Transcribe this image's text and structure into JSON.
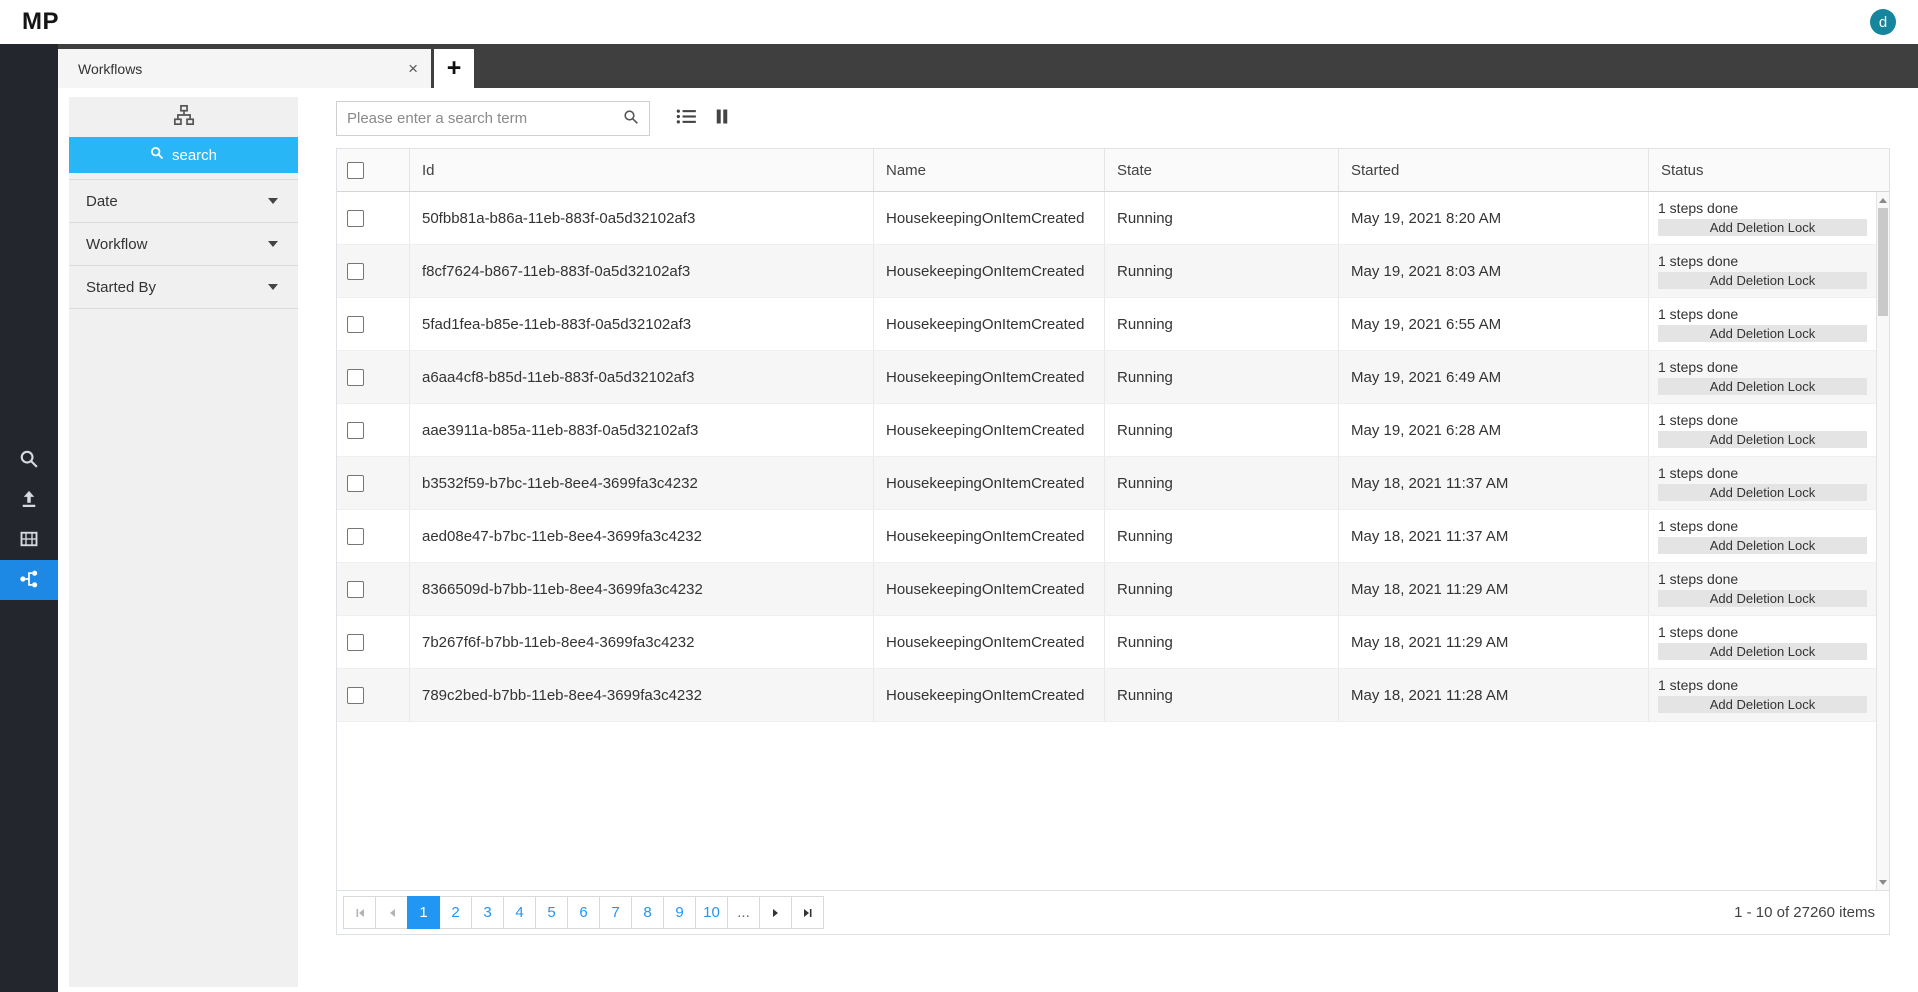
{
  "colors": {
    "rail_dark": "#23272d",
    "tabbar_dark": "#3f3f3f",
    "rail_active_blue": "#1e88e5",
    "search_button_blue": "#29b6f6",
    "pager_selected_blue": "#2196f3",
    "avatar_teal": "#15869e",
    "panel_gray": "#f0f0f0"
  },
  "topbar": {
    "logo": "MP",
    "avatar_initial": "d"
  },
  "rail": {
    "items": [
      {
        "icon": "search-icon",
        "active": false
      },
      {
        "icon": "upload-icon",
        "active": false
      },
      {
        "icon": "media-icon",
        "active": false
      },
      {
        "icon": "workflow-icon",
        "active": true
      }
    ]
  },
  "tabbar": {
    "tab_label": "Workflows",
    "close_glyph": "×",
    "new_tab_glyph": "+"
  },
  "filter_panel": {
    "search_button_label": "search",
    "sections": [
      {
        "label": "Date"
      },
      {
        "label": "Workflow"
      },
      {
        "label": "Started By"
      }
    ]
  },
  "toolbar": {
    "search_placeholder": "Please enter a search term"
  },
  "grid": {
    "columns": [
      "Id",
      "Name",
      "State",
      "Started",
      "Status"
    ],
    "rows": [
      {
        "id": "50fbb81a-b86a-11eb-883f-0a5d32102af3",
        "name": "HousekeepingOnItemCreated",
        "state": "Running",
        "started": "May 19, 2021 8:20 AM",
        "steps": "1 steps done",
        "action": "Add Deletion Lock"
      },
      {
        "id": "f8cf7624-b867-11eb-883f-0a5d32102af3",
        "name": "HousekeepingOnItemCreated",
        "state": "Running",
        "started": "May 19, 2021 8:03 AM",
        "steps": "1 steps done",
        "action": "Add Deletion Lock"
      },
      {
        "id": "5fad1fea-b85e-11eb-883f-0a5d32102af3",
        "name": "HousekeepingOnItemCreated",
        "state": "Running",
        "started": "May 19, 2021 6:55 AM",
        "steps": "1 steps done",
        "action": "Add Deletion Lock"
      },
      {
        "id": "a6aa4cf8-b85d-11eb-883f-0a5d32102af3",
        "name": "HousekeepingOnItemCreated",
        "state": "Running",
        "started": "May 19, 2021 6:49 AM",
        "steps": "1 steps done",
        "action": "Add Deletion Lock"
      },
      {
        "id": "aae3911a-b85a-11eb-883f-0a5d32102af3",
        "name": "HousekeepingOnItemCreated",
        "state": "Running",
        "started": "May 19, 2021 6:28 AM",
        "steps": "1 steps done",
        "action": "Add Deletion Lock"
      },
      {
        "id": "b3532f59-b7bc-11eb-8ee4-3699fa3c4232",
        "name": "HousekeepingOnItemCreated",
        "state": "Running",
        "started": "May 18, 2021 11:37 AM",
        "steps": "1 steps done",
        "action": "Add Deletion Lock"
      },
      {
        "id": "aed08e47-b7bc-11eb-8ee4-3699fa3c4232",
        "name": "HousekeepingOnItemCreated",
        "state": "Running",
        "started": "May 18, 2021 11:37 AM",
        "steps": "1 steps done",
        "action": "Add Deletion Lock"
      },
      {
        "id": "8366509d-b7bb-11eb-8ee4-3699fa3c4232",
        "name": "HousekeepingOnItemCreated",
        "state": "Running",
        "started": "May 18, 2021 11:29 AM",
        "steps": "1 steps done",
        "action": "Add Deletion Lock"
      },
      {
        "id": "7b267f6f-b7bb-11eb-8ee4-3699fa3c4232",
        "name": "HousekeepingOnItemCreated",
        "state": "Running",
        "started": "May 18, 2021 11:29 AM",
        "steps": "1 steps done",
        "action": "Add Deletion Lock"
      },
      {
        "id": "789c2bed-b7bb-11eb-8ee4-3699fa3c4232",
        "name": "HousekeepingOnItemCreated",
        "state": "Running",
        "started": "May 18, 2021 11:28 AM",
        "steps": "1 steps done",
        "action": "Add Deletion Lock"
      }
    ]
  },
  "pager": {
    "pages": [
      "1",
      "2",
      "3",
      "4",
      "5",
      "6",
      "7",
      "8",
      "9",
      "10",
      "..."
    ],
    "current_page": "1",
    "summary": "1 - 10 of 27260 items"
  }
}
